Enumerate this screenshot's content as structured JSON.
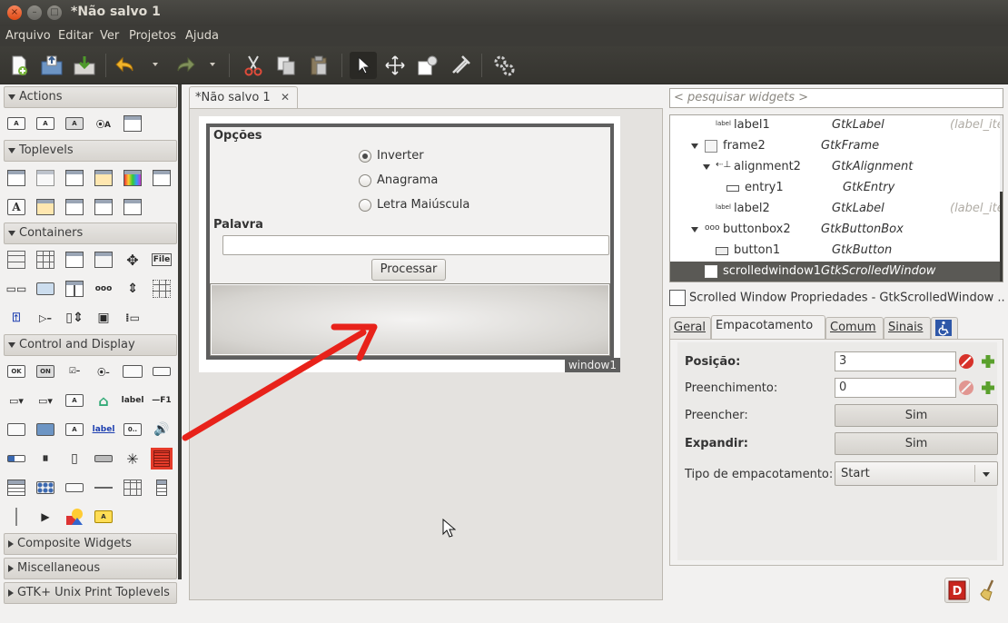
{
  "window": {
    "title": "*Não salvo 1",
    "close_glyph": "×",
    "min_glyph": "–",
    "max_glyph": "□"
  },
  "menu": [
    "Arquivo",
    "Editar",
    "Ver",
    "Projetos",
    "Ajuda"
  ],
  "toolbar": {
    "icons": [
      "new-icon",
      "open-icon",
      "save-icon",
      "undo-icon",
      "redo-icon",
      "cut-icon",
      "copy-icon",
      "paste-icon",
      "pointer-icon",
      "drag-resize-icon",
      "edit-widget-icon",
      "clear-icon",
      "preferences-icon"
    ]
  },
  "palette": {
    "groups": [
      {
        "label": "Actions",
        "expanded": true
      },
      {
        "label": "Toplevels",
        "expanded": true
      },
      {
        "label": "Containers",
        "expanded": true
      },
      {
        "label": "Control and Display",
        "expanded": true
      },
      {
        "label": "Composite Widgets",
        "expanded": false
      },
      {
        "label": "Miscellaneous",
        "expanded": false
      },
      {
        "label": "GTK+ Unix Print Toplevels",
        "expanded": false
      }
    ],
    "icon_text": {
      "file": "File",
      "ok": "OK",
      "on": "ON",
      "label": "label",
      "f1": "—F1",
      "a": "A",
      "zero": "0.."
    }
  },
  "document": {
    "tab_label": "*Não salvo 1",
    "tab_close": "✕",
    "window_label": "window1",
    "frame_label": "Opções",
    "radios": [
      {
        "label": "Inverter",
        "checked": true
      },
      {
        "label": "Anagrama",
        "checked": false
      },
      {
        "label": "Letra Maiúscula",
        "checked": false
      }
    ],
    "word_label": "Palavra",
    "button_label": "Processar"
  },
  "inspector": {
    "search_placeholder": "< pesquisar widgets >",
    "rows": [
      {
        "name": "label1",
        "type": "GtkLabel",
        "extra": "(label_iter",
        "icon": "label",
        "selected": false
      },
      {
        "name": "frame2",
        "type": "GtkFrame",
        "extra": "",
        "icon": "",
        "selected": false
      },
      {
        "name": "alignment2",
        "type": "GtkAlignment",
        "extra": "",
        "icon": "",
        "selected": false
      },
      {
        "name": "entry1",
        "type": "GtkEntry",
        "extra": "",
        "icon": "",
        "selected": false
      },
      {
        "name": "label2",
        "type": "GtkLabel",
        "extra": "(label_iter",
        "icon": "label",
        "selected": false
      },
      {
        "name": "buttonbox2",
        "type": "GtkButtonBox",
        "extra": "",
        "icon": "ooo",
        "selected": false
      },
      {
        "name": "button1",
        "type": "GtkButton",
        "extra": "",
        "icon": "",
        "selected": false
      },
      {
        "name": "scrolledwindow1",
        "type": "GtkScrolledWindow",
        "extra": "",
        "icon": "",
        "selected": true
      }
    ]
  },
  "properties": {
    "title": "Scrolled Window Propriedades - GtkScrolledWindow ...",
    "tabs": [
      {
        "label": "Geral",
        "active": false
      },
      {
        "label": "Empacotamento",
        "active": true
      },
      {
        "label": "Comum",
        "active": false
      },
      {
        "label": "Sinais",
        "active": false
      },
      {
        "label": "",
        "active": false,
        "icon": "accessibility-icon"
      }
    ],
    "fields": {
      "position_label": "Posição:",
      "position_value": "3",
      "padding_label": "Preenchimento:",
      "padding_value": "0",
      "fill_label": "Preencher:",
      "fill_value": "Sim",
      "expand_label": "Expandir:",
      "expand_value": "Sim",
      "pack_type_label": "Tipo de empacotamento:",
      "pack_type_value": "Start"
    }
  },
  "colors": {
    "accent_red": "#e53b2a",
    "titlebar": "#3c3b37",
    "selection": "#5a5955"
  }
}
